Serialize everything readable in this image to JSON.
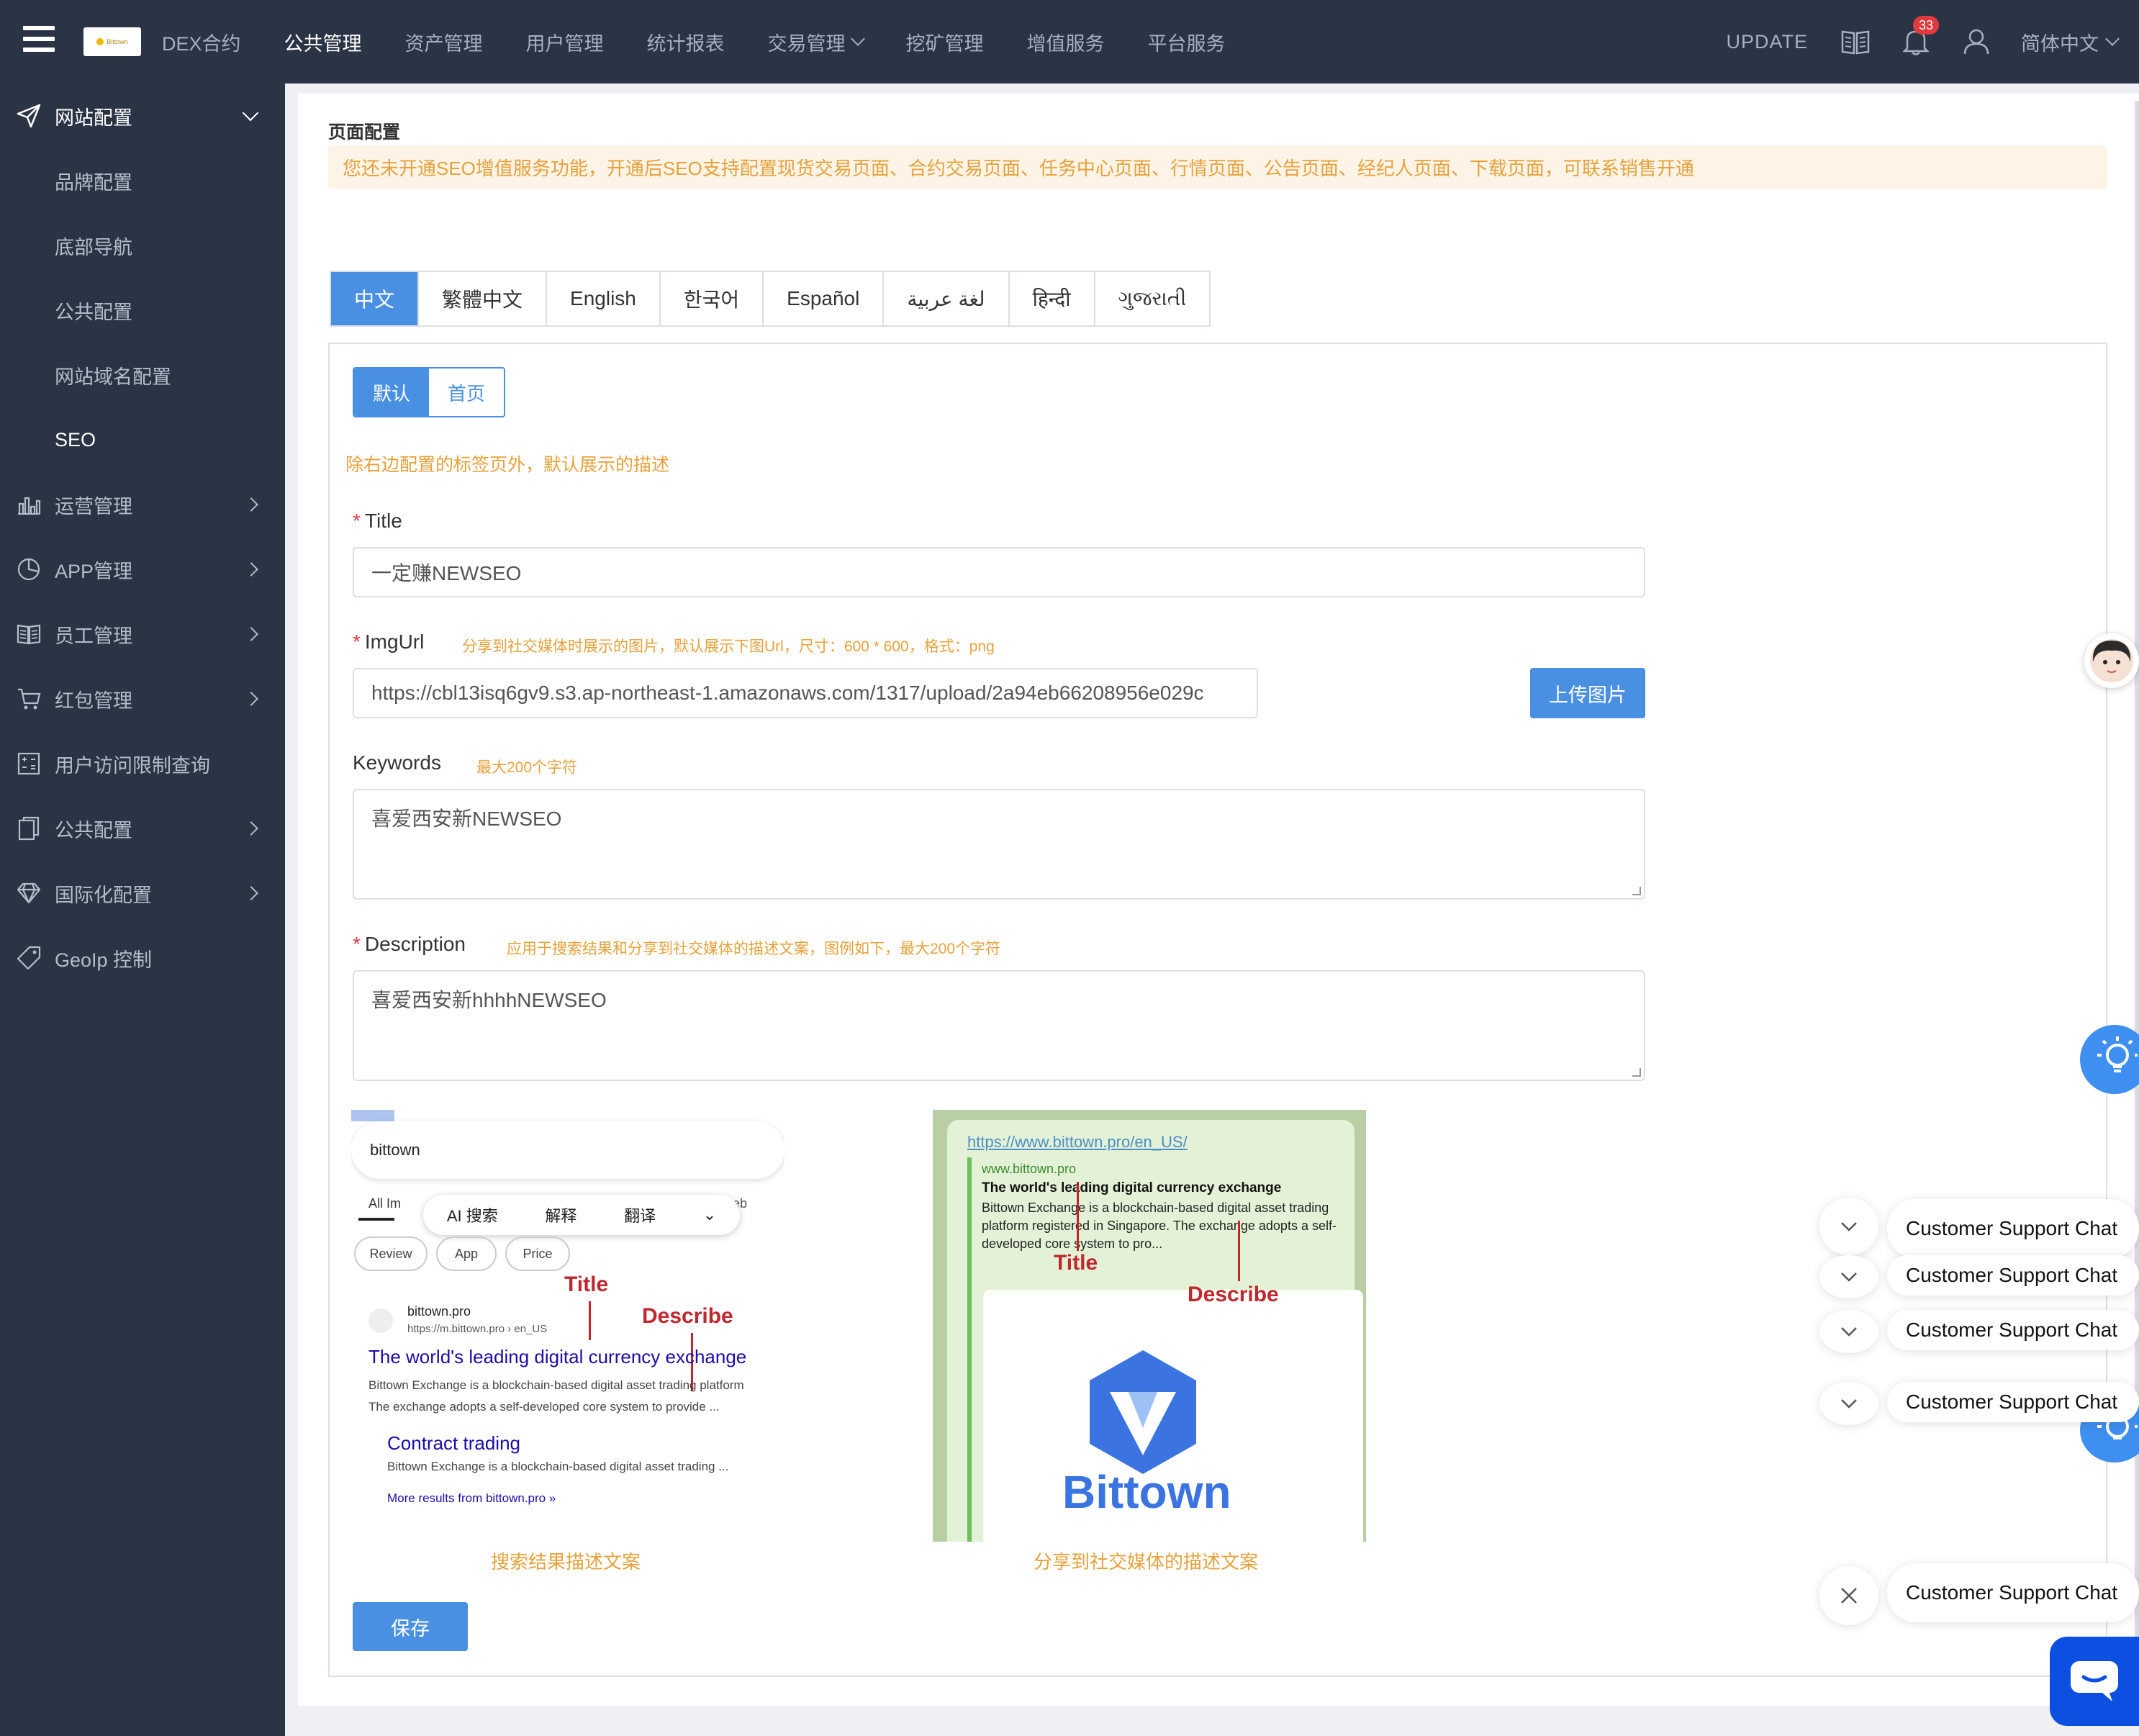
{
  "header": {
    "nav": [
      {
        "label": "DEX合约",
        "active": false
      },
      {
        "label": "公共管理",
        "active": true
      },
      {
        "label": "资产管理",
        "active": false
      },
      {
        "label": "用户管理",
        "active": false
      },
      {
        "label": "统计报表",
        "active": false
      },
      {
        "label": "交易管理",
        "active": false,
        "dropdown": true
      },
      {
        "label": "挖矿管理",
        "active": false
      },
      {
        "label": "增值服务",
        "active": false
      },
      {
        "label": "平台服务",
        "active": false
      }
    ],
    "update_label": "UPDATE",
    "notification_count": "33",
    "language": "简体中文"
  },
  "sidebar": {
    "group_open": {
      "label": "网站配置",
      "icon": "send-icon"
    },
    "sub_items": [
      {
        "label": "品牌配置",
        "active": false
      },
      {
        "label": "底部导航",
        "active": false
      },
      {
        "label": "公共配置",
        "active": false
      },
      {
        "label": "网站域名配置",
        "active": false
      },
      {
        "label": "SEO",
        "active": true
      }
    ],
    "items": [
      {
        "label": "运营管理",
        "icon": "bar-chart-icon",
        "has_children": true
      },
      {
        "label": "APP管理",
        "icon": "pie-chart-icon",
        "has_children": true
      },
      {
        "label": "员工管理",
        "icon": "book-icon",
        "has_children": true
      },
      {
        "label": "红包管理",
        "icon": "cart-icon",
        "has_children": true
      },
      {
        "label": "用户访问限制查询",
        "icon": "calculator-icon",
        "has_children": false
      },
      {
        "label": "公共配置",
        "icon": "clipboard-icon",
        "has_children": true
      },
      {
        "label": "国际化配置",
        "icon": "diamond-icon",
        "has_children": true
      },
      {
        "label": "GeoIp 控制",
        "icon": "tag-icon",
        "has_children": false
      }
    ]
  },
  "page": {
    "title": "页面配置",
    "notice": "您还未开通SEO增值服务功能，开通后SEO支持配置现货交易页面、合约交易页面、任务中心页面、行情页面、公告页面、经纪人页面、下载页面，可联系销售开通"
  },
  "lang_tabs": [
    "中文",
    "繁體中文",
    "English",
    "한국어",
    "Español",
    "لغة عربية",
    "हिन्दी",
    "ગુજરાતી"
  ],
  "sub_tabs": [
    "默认",
    "首页"
  ],
  "form": {
    "default_hint": "除右边配置的标签页外，默认展示的描述",
    "title_label": "Title",
    "title_value": "一定赚NEWSEO",
    "imgurl_label": "ImgUrl",
    "imgurl_hint": "分享到社交媒体时展示的图片，默认展示下图Url，尺寸：600 * 600，格式：png",
    "imgurl_value": "https://cbl13isq6gv9.s3.ap-northeast-1.amazonaws.com/1317/upload/2a94eb66208956e029c",
    "upload_label": "上传图片",
    "keywords_label": "Keywords",
    "keywords_hint": "最大200个字符",
    "keywords_value": "喜爱西安新NEWSEO",
    "description_label": "Description",
    "description_hint": "应用于搜索结果和分享到社交媒体的描述文案，图例如下，最大200个字符",
    "description_value": "喜爱西安新hhhhNEWSEO",
    "save_label": "保存"
  },
  "preview_search": {
    "query": "bittown",
    "tabs": "All    Im",
    "tab_web": "eb",
    "popup": [
      "AI 搜索",
      "解释",
      "翻译"
    ],
    "chips": [
      "Review",
      "App",
      "Price"
    ],
    "site": "bittown.pro",
    "url": "https://m.bittown.pro › en_US",
    "result_title": "The world's leading digital currency exchange",
    "result_desc_1": "Bittown Exchange is a blockchain-based digital asset trading platform",
    "result_desc_2": "The exchange adopts a self-developed core system to provide ...",
    "sub_title": "Contract trading",
    "sub_desc": "Bittown Exchange is a blockchain-based digital asset trading ...",
    "more": "More results from bittown.pro »",
    "anno_title": "Title",
    "anno_describe": "Describe",
    "caption": "搜索结果描述文案"
  },
  "preview_social": {
    "link": "https://www.bittown.pro/en_US/",
    "site": "www.bittown.pro",
    "title": "The world's leading digital currency exchange",
    "desc": "Bittown Exchange is a blockchain-based digital asset trading platform registered in Singapore. The exchange adopts a self-developed core system to pro...",
    "brand": "Bittown",
    "anno_title": "Title",
    "anno_describe": "Describe",
    "caption": "分享到社交媒体的描述文案"
  },
  "support": {
    "chat_label": "Customer Support Chat"
  },
  "colors": {
    "sidebar_bg": "#2b3445",
    "primary": "#4a90e2",
    "warning": "#e6a23c",
    "danger": "#e0393e"
  }
}
